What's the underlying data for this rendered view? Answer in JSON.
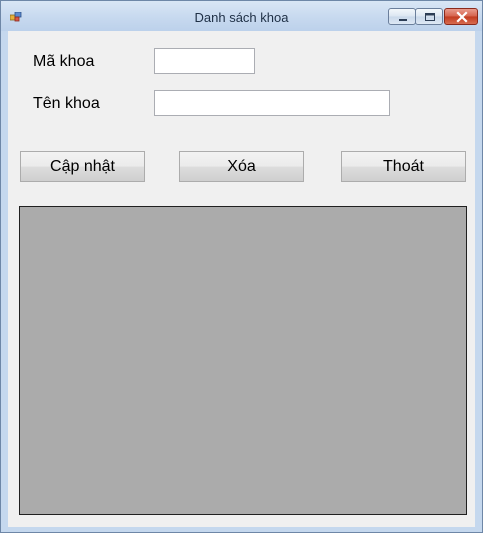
{
  "window": {
    "title": "Danh sách khoa",
    "app_icon": "form-icon",
    "caption_buttons": [
      "minimize-icon",
      "maximize-icon",
      "close-icon"
    ]
  },
  "form": {
    "ma_khoa_label": "Mã khoa",
    "ma_khoa_value": "",
    "ten_khoa_label": "Tên khoa",
    "ten_khoa_value": ""
  },
  "buttons": {
    "update_label": "Cập nhật",
    "delete_label": "Xóa",
    "exit_label": "Thoát"
  },
  "grid": {
    "rows": [],
    "background": "#ababab"
  }
}
